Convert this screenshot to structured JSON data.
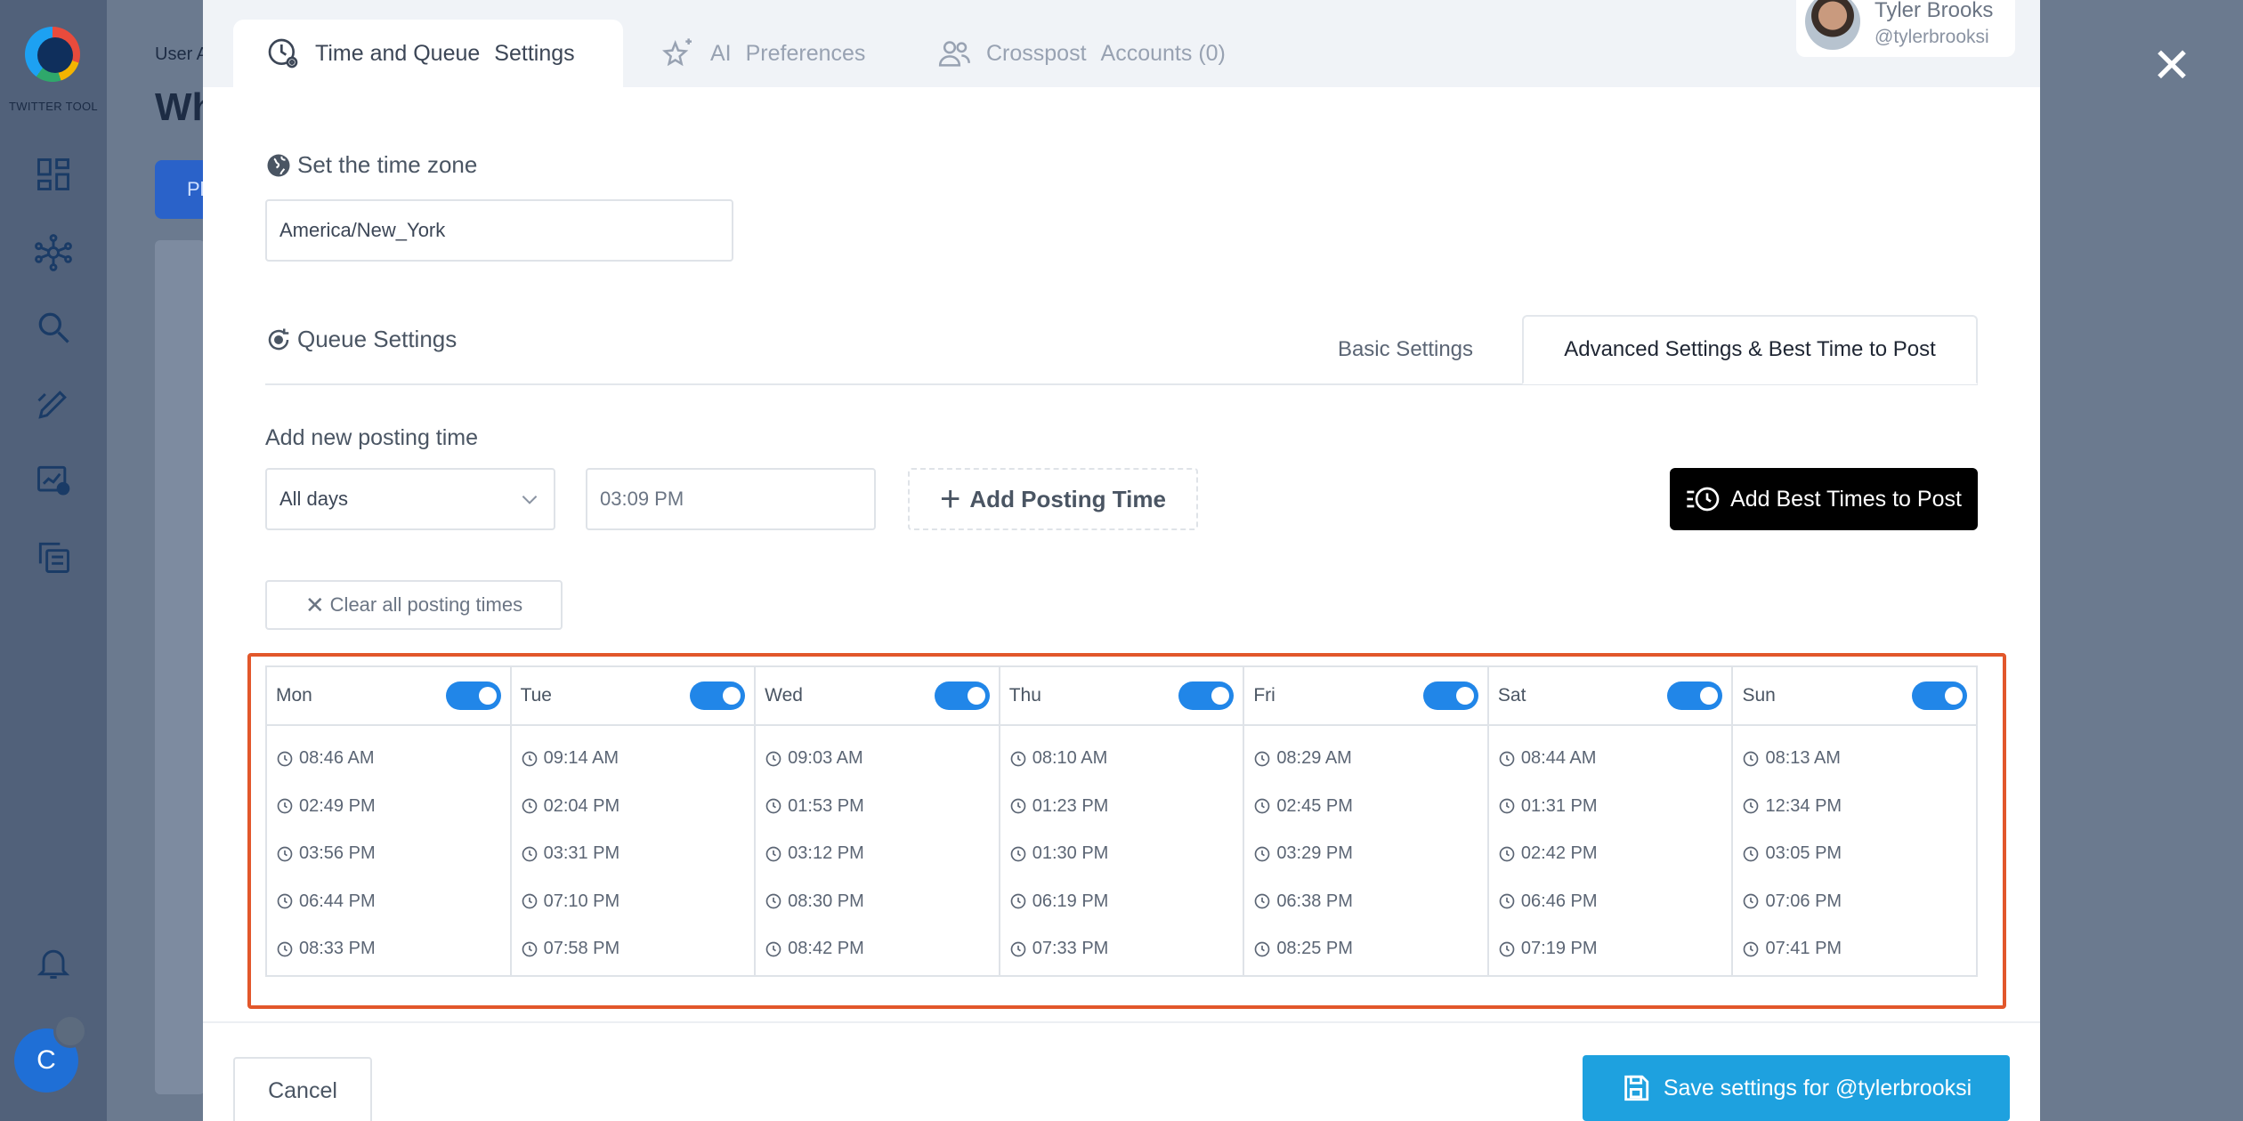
{
  "app": {
    "logo_text": "TWITTER TOOL",
    "breadcrumb": "User A",
    "page_title": "Wh",
    "bg_button": "Pl",
    "user_initial": "C"
  },
  "modal": {
    "tabs": [
      {
        "label": "Time and Queue",
        "label2": "Settings",
        "icon": "clock-gear-icon"
      },
      {
        "label": "AI",
        "label2": "Preferences",
        "icon": "sparkle-star-icon"
      },
      {
        "label": "Crosspost",
        "label2": "Accounts (0)",
        "icon": "users-icon"
      }
    ],
    "profile": {
      "name": "Tyler Brooks",
      "handle": "@tylerbrooksi"
    },
    "timezone": {
      "label": "Set the time zone",
      "value": "America/New_York"
    },
    "queue": {
      "label": "Queue Settings",
      "basic_tab": "Basic Settings",
      "advanced_tab": "Advanced Settings & Best Time to Post"
    },
    "add_posting": {
      "label": "Add new posting time",
      "days_select": "All days",
      "time_value": "03:09 PM",
      "add_button": "Add Posting Time",
      "best_times_button": "Add Best Times to Post",
      "clear_button": "Clear all posting times"
    },
    "schedule": [
      {
        "day": "Mon",
        "enabled": true,
        "times": [
          "08:46 AM",
          "02:49 PM",
          "03:56 PM",
          "06:44 PM",
          "08:33 PM"
        ]
      },
      {
        "day": "Tue",
        "enabled": true,
        "times": [
          "09:14 AM",
          "02:04 PM",
          "03:31 PM",
          "07:10 PM",
          "07:58 PM"
        ]
      },
      {
        "day": "Wed",
        "enabled": true,
        "times": [
          "09:03 AM",
          "01:53 PM",
          "03:12 PM",
          "08:30 PM",
          "08:42 PM"
        ]
      },
      {
        "day": "Thu",
        "enabled": true,
        "times": [
          "08:10 AM",
          "01:23 PM",
          "01:30 PM",
          "06:19 PM",
          "07:33 PM"
        ]
      },
      {
        "day": "Fri",
        "enabled": true,
        "times": [
          "08:29 AM",
          "02:45 PM",
          "03:29 PM",
          "06:38 PM",
          "08:25 PM"
        ]
      },
      {
        "day": "Sat",
        "enabled": true,
        "times": [
          "08:44 AM",
          "01:31 PM",
          "02:42 PM",
          "06:46 PM",
          "07:19 PM"
        ]
      },
      {
        "day": "Sun",
        "enabled": true,
        "times": [
          "08:13 AM",
          "12:34 PM",
          "03:05 PM",
          "07:06 PM",
          "07:41 PM"
        ]
      }
    ],
    "footer": {
      "cancel": "Cancel",
      "save": "Save settings for @tylerbrooksi"
    },
    "colors": {
      "highlight": "#e2572b",
      "toggle": "#2186e8",
      "save": "#1ea1df"
    }
  }
}
